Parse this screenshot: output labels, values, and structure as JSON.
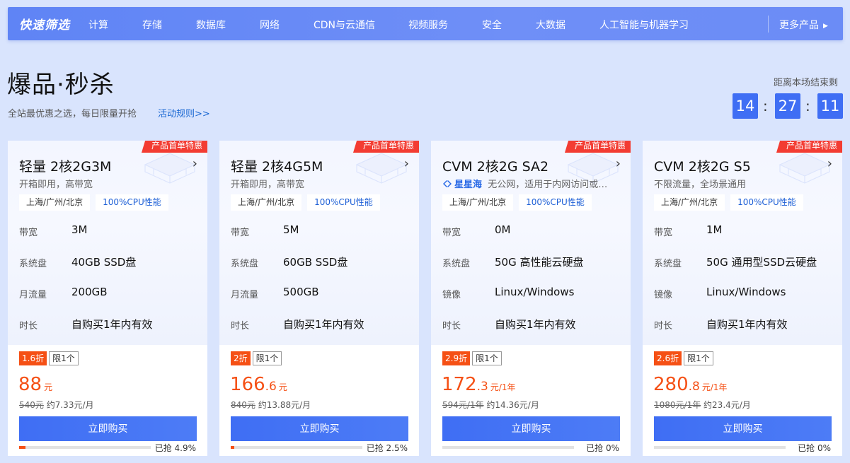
{
  "nav": {
    "logo": "快速筛选",
    "items": [
      "计算",
      "存储",
      "数据库",
      "网络",
      "CDN与云通信",
      "视频服务",
      "安全",
      "大数据",
      "人工智能与机器学习"
    ],
    "more": "更多产品"
  },
  "hero": {
    "title": "爆品·秒杀",
    "subtitle": "全站最优惠之选，每日限量开抢",
    "rules_link": "活动规则>>",
    "countdown_label": "距离本场结束剩",
    "countdown": [
      "14",
      "27",
      "11"
    ]
  },
  "cards": [
    {
      "tag": "产品首单特惠",
      "title": "轻量 2核2G3M",
      "brand": "",
      "desc": "开箱即用，高带宽",
      "chips": [
        "上海/广州/北京",
        "100%CPU性能"
      ],
      "specs": [
        {
          "label": "带宽",
          "value": "3M"
        },
        {
          "label": "系统盘",
          "value": "40GB SSD盘"
        },
        {
          "label": "月流量",
          "value": "200GB"
        },
        {
          "label": "时长",
          "value": "自购买1年内有效"
        }
      ],
      "discount": "1.6折",
      "limit": "限1个",
      "price_int": "88",
      "price_dec": "",
      "price_unit": "元",
      "orig_price": "540元",
      "monthly": "约7.33元/月",
      "buy": "立即购买",
      "sold": "已抢 4.9%",
      "sold_pct": 4.9
    },
    {
      "tag": "产品首单特惠",
      "title": "轻量 2核4G5M",
      "brand": "",
      "desc": "开箱即用，高带宽",
      "chips": [
        "上海/广州/北京",
        "100%CPU性能"
      ],
      "specs": [
        {
          "label": "带宽",
          "value": "5M"
        },
        {
          "label": "系统盘",
          "value": "60GB SSD盘"
        },
        {
          "label": "月流量",
          "value": "500GB"
        },
        {
          "label": "时长",
          "value": "自购买1年内有效"
        }
      ],
      "discount": "2折",
      "limit": "限1个",
      "price_int": "166",
      "price_dec": ".6",
      "price_unit": "元",
      "orig_price": "840元",
      "monthly": "约13.88元/月",
      "buy": "立即购买",
      "sold": "已抢 2.5%",
      "sold_pct": 2.5
    },
    {
      "tag": "产品首单特惠",
      "title": "CVM 2核2G SA2",
      "brand": "星星海",
      "desc": "无公网，适用于内网访问或…",
      "chips": [
        "上海/广州/北京",
        "100%CPU性能"
      ],
      "specs": [
        {
          "label": "带宽",
          "value": "0M"
        },
        {
          "label": "系统盘",
          "value": "50G 高性能云硬盘"
        },
        {
          "label": "镜像",
          "value": "Linux/Windows"
        },
        {
          "label": "时长",
          "value": "自购买1年内有效"
        }
      ],
      "discount": "2.9折",
      "limit": "限1个",
      "price_int": "172",
      "price_dec": ".3",
      "price_unit": "元/1年",
      "orig_price": "594元/1年",
      "monthly": "约14.36元/月",
      "buy": "立即购买",
      "sold": "已抢 0%",
      "sold_pct": 0
    },
    {
      "tag": "产品首单特惠",
      "title": "CVM 2核2G S5",
      "brand": "",
      "desc": "不限流量，全场景通用",
      "chips": [
        "上海/广州/北京",
        "100%CPU性能"
      ],
      "specs": [
        {
          "label": "带宽",
          "value": "1M"
        },
        {
          "label": "系统盘",
          "value": "50G 通用型SSD云硬盘"
        },
        {
          "label": "镜像",
          "value": "Linux/Windows"
        },
        {
          "label": "时长",
          "value": "自购买1年内有效"
        }
      ],
      "discount": "2.6折",
      "limit": "限1个",
      "price_int": "280",
      "price_dec": ".8",
      "price_unit": "元/1年",
      "orig_price": "1080元/1年",
      "monthly": "约23.4元/月",
      "buy": "立即购买",
      "sold": "已抢 0%",
      "sold_pct": 0
    }
  ]
}
